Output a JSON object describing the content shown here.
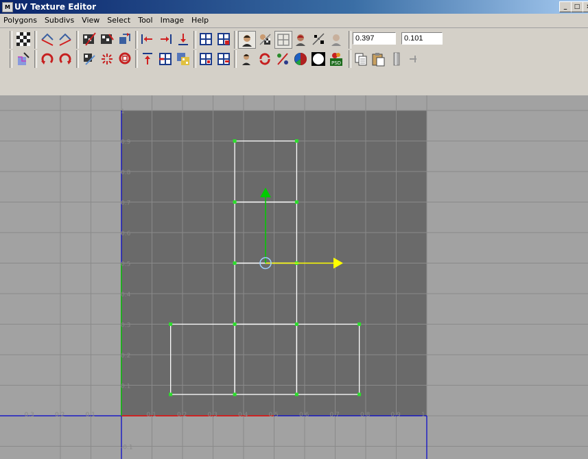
{
  "window": {
    "title": "UV Texture Editor",
    "minimize": "_",
    "maximize": "□",
    "close": "×"
  },
  "menu": [
    "Polygons",
    "Subdivs",
    "View",
    "Select",
    "Tool",
    "Image",
    "Help"
  ],
  "toolbar": {
    "u_value": "0.397",
    "v_value": "0.101",
    "icons": [
      "checker-icon",
      "flip-u-icon",
      "flip-v-icon",
      "cut-uv-icon",
      "sew-uv-icon",
      "layout-icon",
      "align-left-icon",
      "align-right-icon",
      "align-down-icon",
      "grid-icon",
      "grid-add-icon",
      "portrait-icon",
      "texture-toggle-icon",
      "grid-toggle-icon",
      "shaded-icon",
      "dither-icon",
      "portrait-dim-icon",
      "texture-shell-icon",
      "rotate-ccw-icon",
      "rotate-cw-icon",
      "unfold-icon",
      "relax-icon",
      "lasso-icon",
      "align-up-icon",
      "center-icon",
      "snapshot-icon",
      "grid-frame-icon",
      "grid-minus-icon",
      "portrait-small-icon",
      "swap-icon",
      "percent-icon",
      "rgb-icon",
      "white-circle-icon",
      "psd-icon",
      "copy-icon",
      "paste-icon",
      "pin-icon"
    ]
  },
  "uv_axis_labels": {
    "v_ticks": [
      "1",
      "0.9",
      "0.8",
      "0.7",
      "0.6",
      "0.5",
      "0.4",
      "0.3",
      "0.2",
      "0.1",
      "-0.1"
    ],
    "u_ticks": [
      "0.1",
      "0.2",
      "0.3",
      "0.4",
      "0.5",
      "0.6",
      "0.7",
      "0.8",
      "0.9",
      "1"
    ],
    "u_neg_ticks": [
      "0.3",
      "0.2",
      "0.1"
    ]
  },
  "uv_shell": {
    "faces": [
      {
        "u": [
          0.371,
          0.574
        ],
        "v": [
          0.7,
          0.9
        ]
      },
      {
        "u": [
          0.371,
          0.574
        ],
        "v": [
          0.5,
          0.7
        ]
      },
      {
        "u": [
          0.371,
          0.574
        ],
        "v": [
          0.3,
          0.5
        ]
      },
      {
        "u": [
          0.161,
          0.371
        ],
        "v": [
          0.07,
          0.3
        ]
      },
      {
        "u": [
          0.371,
          0.574
        ],
        "v": [
          0.07,
          0.3
        ]
      },
      {
        "u": [
          0.574,
          0.779
        ],
        "v": [
          0.07,
          0.3
        ]
      }
    ],
    "vertex_color": "#2dde2d",
    "edge_color": "#ffffff"
  },
  "manipulator": {
    "u": 0.472,
    "v": 0.5,
    "u_axis_color": "#ffff00",
    "v_axis_color": "#00cc00",
    "pivot_color": "#9ecfff"
  },
  "colors": {
    "uv_tile": "#6a6a6a",
    "background": "#a2a2a2",
    "u_axis": "#cc2222",
    "v_axis": "#22aa22",
    "boundary": "#0000cc"
  }
}
